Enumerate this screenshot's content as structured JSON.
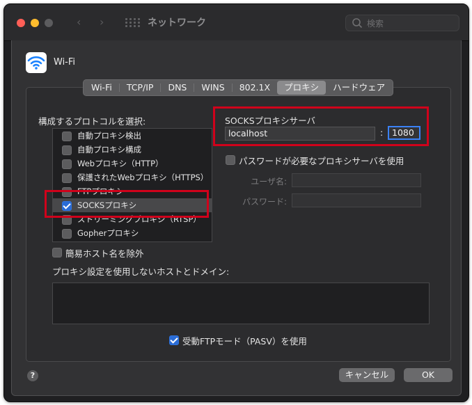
{
  "window": {
    "title": "ネットワーク",
    "search_placeholder": "検索"
  },
  "interface": {
    "name": "Wi-Fi"
  },
  "tabs": [
    {
      "label": "Wi-Fi"
    },
    {
      "label": "TCP/IP"
    },
    {
      "label": "DNS"
    },
    {
      "label": "WINS"
    },
    {
      "label": "802.1X"
    },
    {
      "label": "プロキシ",
      "active": true
    },
    {
      "label": "ハードウェア"
    }
  ],
  "protocols": {
    "heading": "構成するプロトコルを選択:",
    "items": [
      {
        "label": "自動プロキシ検出",
        "checked": false
      },
      {
        "label": "自動プロキシ構成",
        "checked": false
      },
      {
        "label": "Webプロキシ（HTTP）",
        "checked": false
      },
      {
        "label": "保護されたWebプロキシ（HTTPS）",
        "checked": false
      },
      {
        "label": "FTPプロキシ",
        "checked": false
      },
      {
        "label": "SOCKSプロキシ",
        "checked": true,
        "selected": true
      },
      {
        "label": "ストリーミングプロキシ（RTSP）",
        "checked": false
      },
      {
        "label": "Gopherプロキシ",
        "checked": false
      }
    ]
  },
  "server": {
    "heading": "SOCKSプロキシサーバ",
    "host": "localhost",
    "separator": ":",
    "port": "1080",
    "auth_label": "パスワードが必要なプロキシサーバを使用",
    "user_label": "ユーザ名:",
    "password_label": "パスワード:"
  },
  "exclude_simple": {
    "label": "簡易ホスト名を除外"
  },
  "bypass": {
    "label": "プロキシ設定を使用しないホストとドメイン:",
    "value": ""
  },
  "pasv": {
    "label": "受動FTPモード（PASV）を使用",
    "checked": true
  },
  "buttons": {
    "cancel": "キャンセル",
    "ok": "OK",
    "help": "?"
  },
  "colors": {
    "accent": "#2a6cd6",
    "annotation": "#d0021b"
  }
}
